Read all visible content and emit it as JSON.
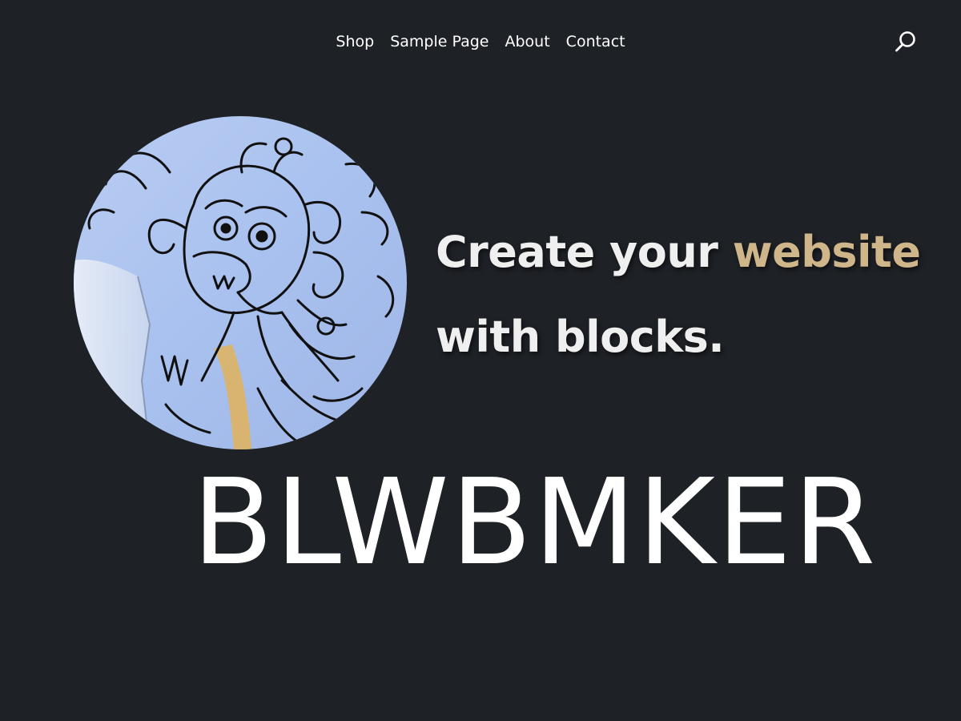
{
  "navigation": {
    "items": [
      {
        "label": "Shop"
      },
      {
        "label": "Sample Page"
      },
      {
        "label": "About"
      },
      {
        "label": "Contact"
      }
    ],
    "search_icon": "search-icon"
  },
  "hero": {
    "title_part1": "Create your ",
    "title_accent": "website",
    "title_part2": " with blocks.",
    "image": "circular-illustration-dragon-drawing"
  },
  "wordmark": {
    "text": "BLWBMKER"
  },
  "colors": {
    "background": "#1e2126",
    "text": "#efefef",
    "accent": "#cfb58a"
  }
}
